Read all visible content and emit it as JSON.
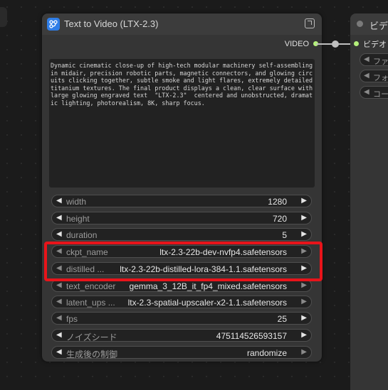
{
  "node": {
    "title": "Text to Video (LTX-2.3)",
    "output_label": "VIDEO",
    "prompt": "Dynamic cinematic close-up of high-tech modular machinery self-assembling in midair, precision robotic parts, magnetic connectors, and glowing circuits clicking together, subtle smoke and light flares, extremely detailed titanium textures. The final product displays a clean, clear surface with large glowing engraved text  \"LTX-2.3\"  centered and unobstructed, dramatic lighting, photorealism, 8K, sharp focus.",
    "widgets": [
      {
        "label": "width",
        "value": "1280"
      },
      {
        "label": "height",
        "value": "720"
      },
      {
        "label": "duration",
        "value": "5"
      },
      {
        "label": "ckpt_name",
        "value": "ltx-2.3-22b-dev-nvfp4.safetensors"
      },
      {
        "label": "distilled ...",
        "value": "ltx-2.3-22b-distilled-lora-384-1.1.safetensors"
      },
      {
        "label": "text_encoder",
        "value": "gemma_3_12B_it_fp4_mixed.safetensors"
      },
      {
        "label": "latent_ups ...",
        "value": "ltx-2.3-spatial-upscaler-x2-1.1.safetensors"
      },
      {
        "label": "fps",
        "value": "25"
      },
      {
        "label": "ノイズシード",
        "value": "475114526593157"
      },
      {
        "label": "生成後の制御",
        "value": "randomize"
      }
    ]
  },
  "node2": {
    "title": "ビデ",
    "input_label": "ビデオ",
    "widgets": [
      {
        "label": "ファ"
      },
      {
        "label": "フォ"
      },
      {
        "label": "コー"
      }
    ]
  },
  "colors": {
    "highlight": "#e8141a",
    "socket": "#b4f07a",
    "node_icon": "#2f7ee8"
  }
}
